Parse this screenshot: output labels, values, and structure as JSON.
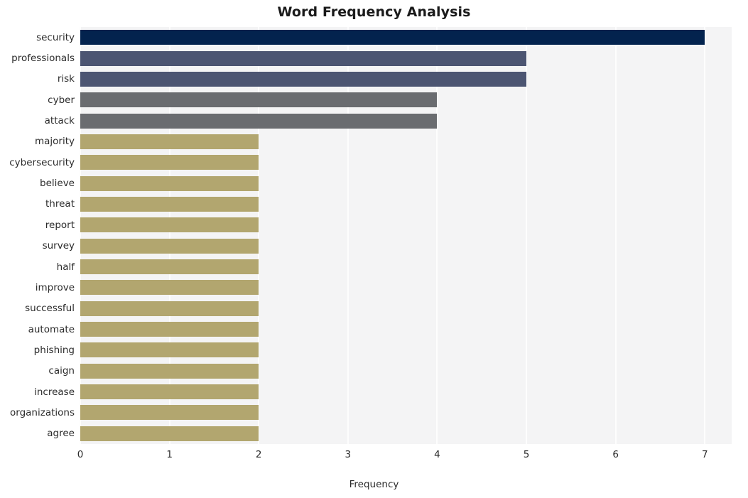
{
  "chart_data": {
    "type": "bar",
    "orientation": "horizontal",
    "title": "Word Frequency Analysis",
    "xlabel": "Frequency",
    "ylabel": "",
    "categories": [
      "security",
      "professionals",
      "risk",
      "cyber",
      "attack",
      "majority",
      "cybersecurity",
      "believe",
      "threat",
      "report",
      "survey",
      "half",
      "improve",
      "successful",
      "automate",
      "phishing",
      "caign",
      "increase",
      "organizations",
      "agree"
    ],
    "values": [
      7,
      5,
      5,
      4,
      4,
      2,
      2,
      2,
      2,
      2,
      2,
      2,
      2,
      2,
      2,
      2,
      2,
      2,
      2,
      2
    ],
    "bar_colors": [
      "#03234e",
      "#4c5572",
      "#4c5572",
      "#6a6c70",
      "#6a6c70",
      "#b2a66f",
      "#b2a66f",
      "#b2a66f",
      "#b2a66f",
      "#b2a66f",
      "#b2a66f",
      "#b2a66f",
      "#b2a66f",
      "#b2a66f",
      "#b2a66f",
      "#b2a66f",
      "#b2a66f",
      "#b2a66f",
      "#b2a66f",
      "#b2a66f"
    ],
    "xlim": [
      0,
      7.3
    ],
    "xticks": [
      0,
      1,
      2,
      3,
      4,
      5,
      6,
      7
    ],
    "xtick_labels": [
      "0",
      "1",
      "2",
      "3",
      "4",
      "5",
      "6",
      "7"
    ],
    "grid": true,
    "grid_axis": "x",
    "grid_color": "#fdfdfd",
    "plot_background": "#f4f4f5",
    "figure_background": "#ffffff",
    "legend": null
  }
}
